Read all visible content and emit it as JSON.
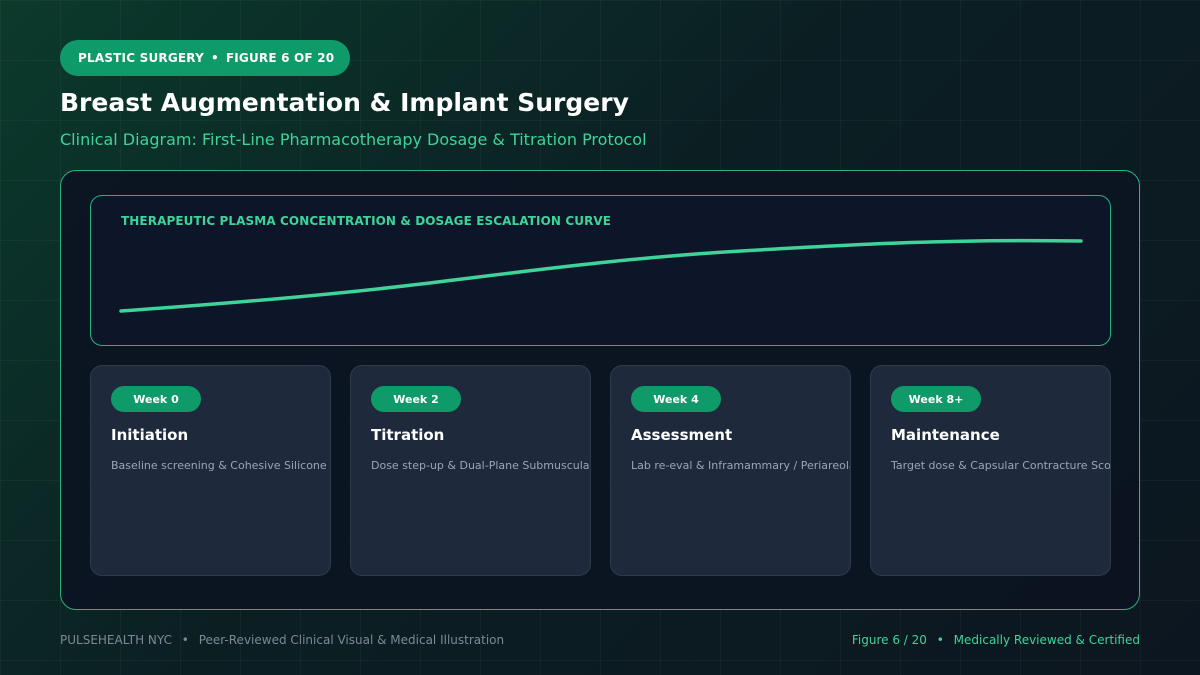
{
  "header": {
    "category": "PLASTIC SURGERY",
    "separator": "•",
    "figure": "FIGURE 6 OF 20",
    "title": "Breast Augmentation & Implant Surgery",
    "subtitle": "Clinical Diagram: First-Line Pharmacotherapy Dosage & Titration Protocol"
  },
  "chart": {
    "title": "THERAPEUTIC PLASMA CONCENTRATION & DOSAGE ESCALATION CURVE",
    "line_color": "#3fd39a"
  },
  "stages": [
    {
      "week": "Week 0",
      "title": "Initiation",
      "desc": "Baseline screening & Cohesive Silicone Implant"
    },
    {
      "week": "Week 2",
      "title": "Titration",
      "desc": "Dose step-up & Dual-Plane Submuscular Pocket"
    },
    {
      "week": "Week 4",
      "title": "Assessment",
      "desc": "Lab re-eval & Inframammary / Periareolar Access"
    },
    {
      "week": "Week 8+",
      "title": "Maintenance",
      "desc": "Target dose & Capsular Contracture Score"
    }
  ],
  "footer": {
    "brand": "PULSEHEALTH NYC",
    "separator": "•",
    "tagline": "Peer-Reviewed Clinical Visual & Medical Illustration",
    "figure": "Figure 6 / 20",
    "status": "Medically Reviewed & Certified"
  },
  "colors": {
    "accent": "#0f9a6a",
    "accent_text": "#3fd39a",
    "panel_border": "#23b57d"
  }
}
